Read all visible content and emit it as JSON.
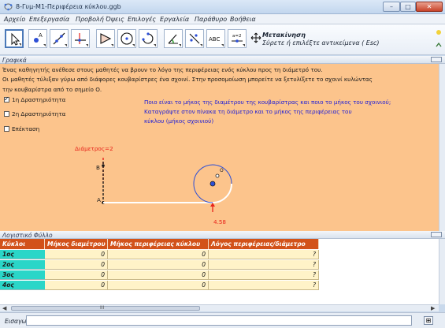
{
  "window": {
    "title": "8-Γυμ-Μ1-Περιφέρεια κύκλου.ggb",
    "controls": [
      "minimize",
      "maximize",
      "close"
    ]
  },
  "menu": [
    "Αρχείο",
    "Επεξεργασία",
    "Προβολή",
    "Όψεις",
    "Επιλογές",
    "Εργαλεία",
    "Παράθυρο",
    "Βοήθεια"
  ],
  "toolbar": {
    "tools": [
      "move",
      "point",
      "line",
      "perpendicular",
      "polygon",
      "circle",
      "arc",
      "angle",
      "reflect",
      "text",
      "slider",
      "move-view"
    ],
    "active_title": "Μετακίνηση",
    "active_desc": "Σύρετε ή επιλέξτε αντικείμενα ( Esc)",
    "text_tool_label": "ABC",
    "slider_tool_label": "a=2"
  },
  "graphics": {
    "header": "Γραφικά",
    "line1": "Ένας καθηγητής ανέθεσε στους μαθητές να βρουν το λόγο της περιφέρειας ενός κύκλου προς τη διάμετρό του.",
    "line2": "Οι μαθητές τύλιξαν γύρω από διάφορες κουβαρίστρες ένα σχοινί. Στην προσομοίωση μπορείτε να ξετυλίξετε το σχοινί κυλώντας",
    "line3": "την κουβαρίστρα από το σημείο Ο.",
    "checkboxes": [
      {
        "label": "1η Δραστηριότητα",
        "checked": true
      },
      {
        "label": "2η Δραστηριότητα",
        "checked": false
      },
      {
        "label": "Επέκταση",
        "checked": false
      }
    ],
    "question": [
      "Ποιο είναι το  μήκος της διαμέτρου της κουβαρίστρας και ποιο το μήκος του σχοινιού;",
      "Καταγράψτε στον πίνακα τη διάμετρο και το μήκος της περιφέρειας του",
      "κύκλου (μήκος σχοινιού)"
    ],
    "diameter_label": "Διάμετρος=2",
    "point_b": "B",
    "point_a": "A",
    "point_o": "O",
    "length_label": "4.58",
    "colors": {
      "background": "#fcc48c",
      "diameter": "#e8231a",
      "circle": "#2d4fd6",
      "question": "#1c1cd8"
    }
  },
  "spreadsheet": {
    "header": "Λογιστικό Φύλλο",
    "columns": [
      "Κύκλοι",
      "Μήκος διαμέτρου",
      "Μήκος περιφέρειας κύκλου",
      "Λόγος περιφέρειας/διάμετρο"
    ],
    "rows": [
      {
        "label": "1ος",
        "diameter": "0",
        "circumference": "0",
        "ratio": "?"
      },
      {
        "label": "2ος",
        "diameter": "0",
        "circumference": "0",
        "ratio": "?"
      },
      {
        "label": "3ος",
        "diameter": "0",
        "circumference": "0",
        "ratio": "?"
      },
      {
        "label": "4ος",
        "diameter": "0",
        "circumference": "0",
        "ratio": "?"
      }
    ],
    "scroll_grip": "III",
    "colors": {
      "header": "#d2521a",
      "row_label": "#2ad6c8",
      "cell": "#fff3c8"
    }
  },
  "input_bar": {
    "label": "Εισαγωγή:",
    "value": ""
  }
}
